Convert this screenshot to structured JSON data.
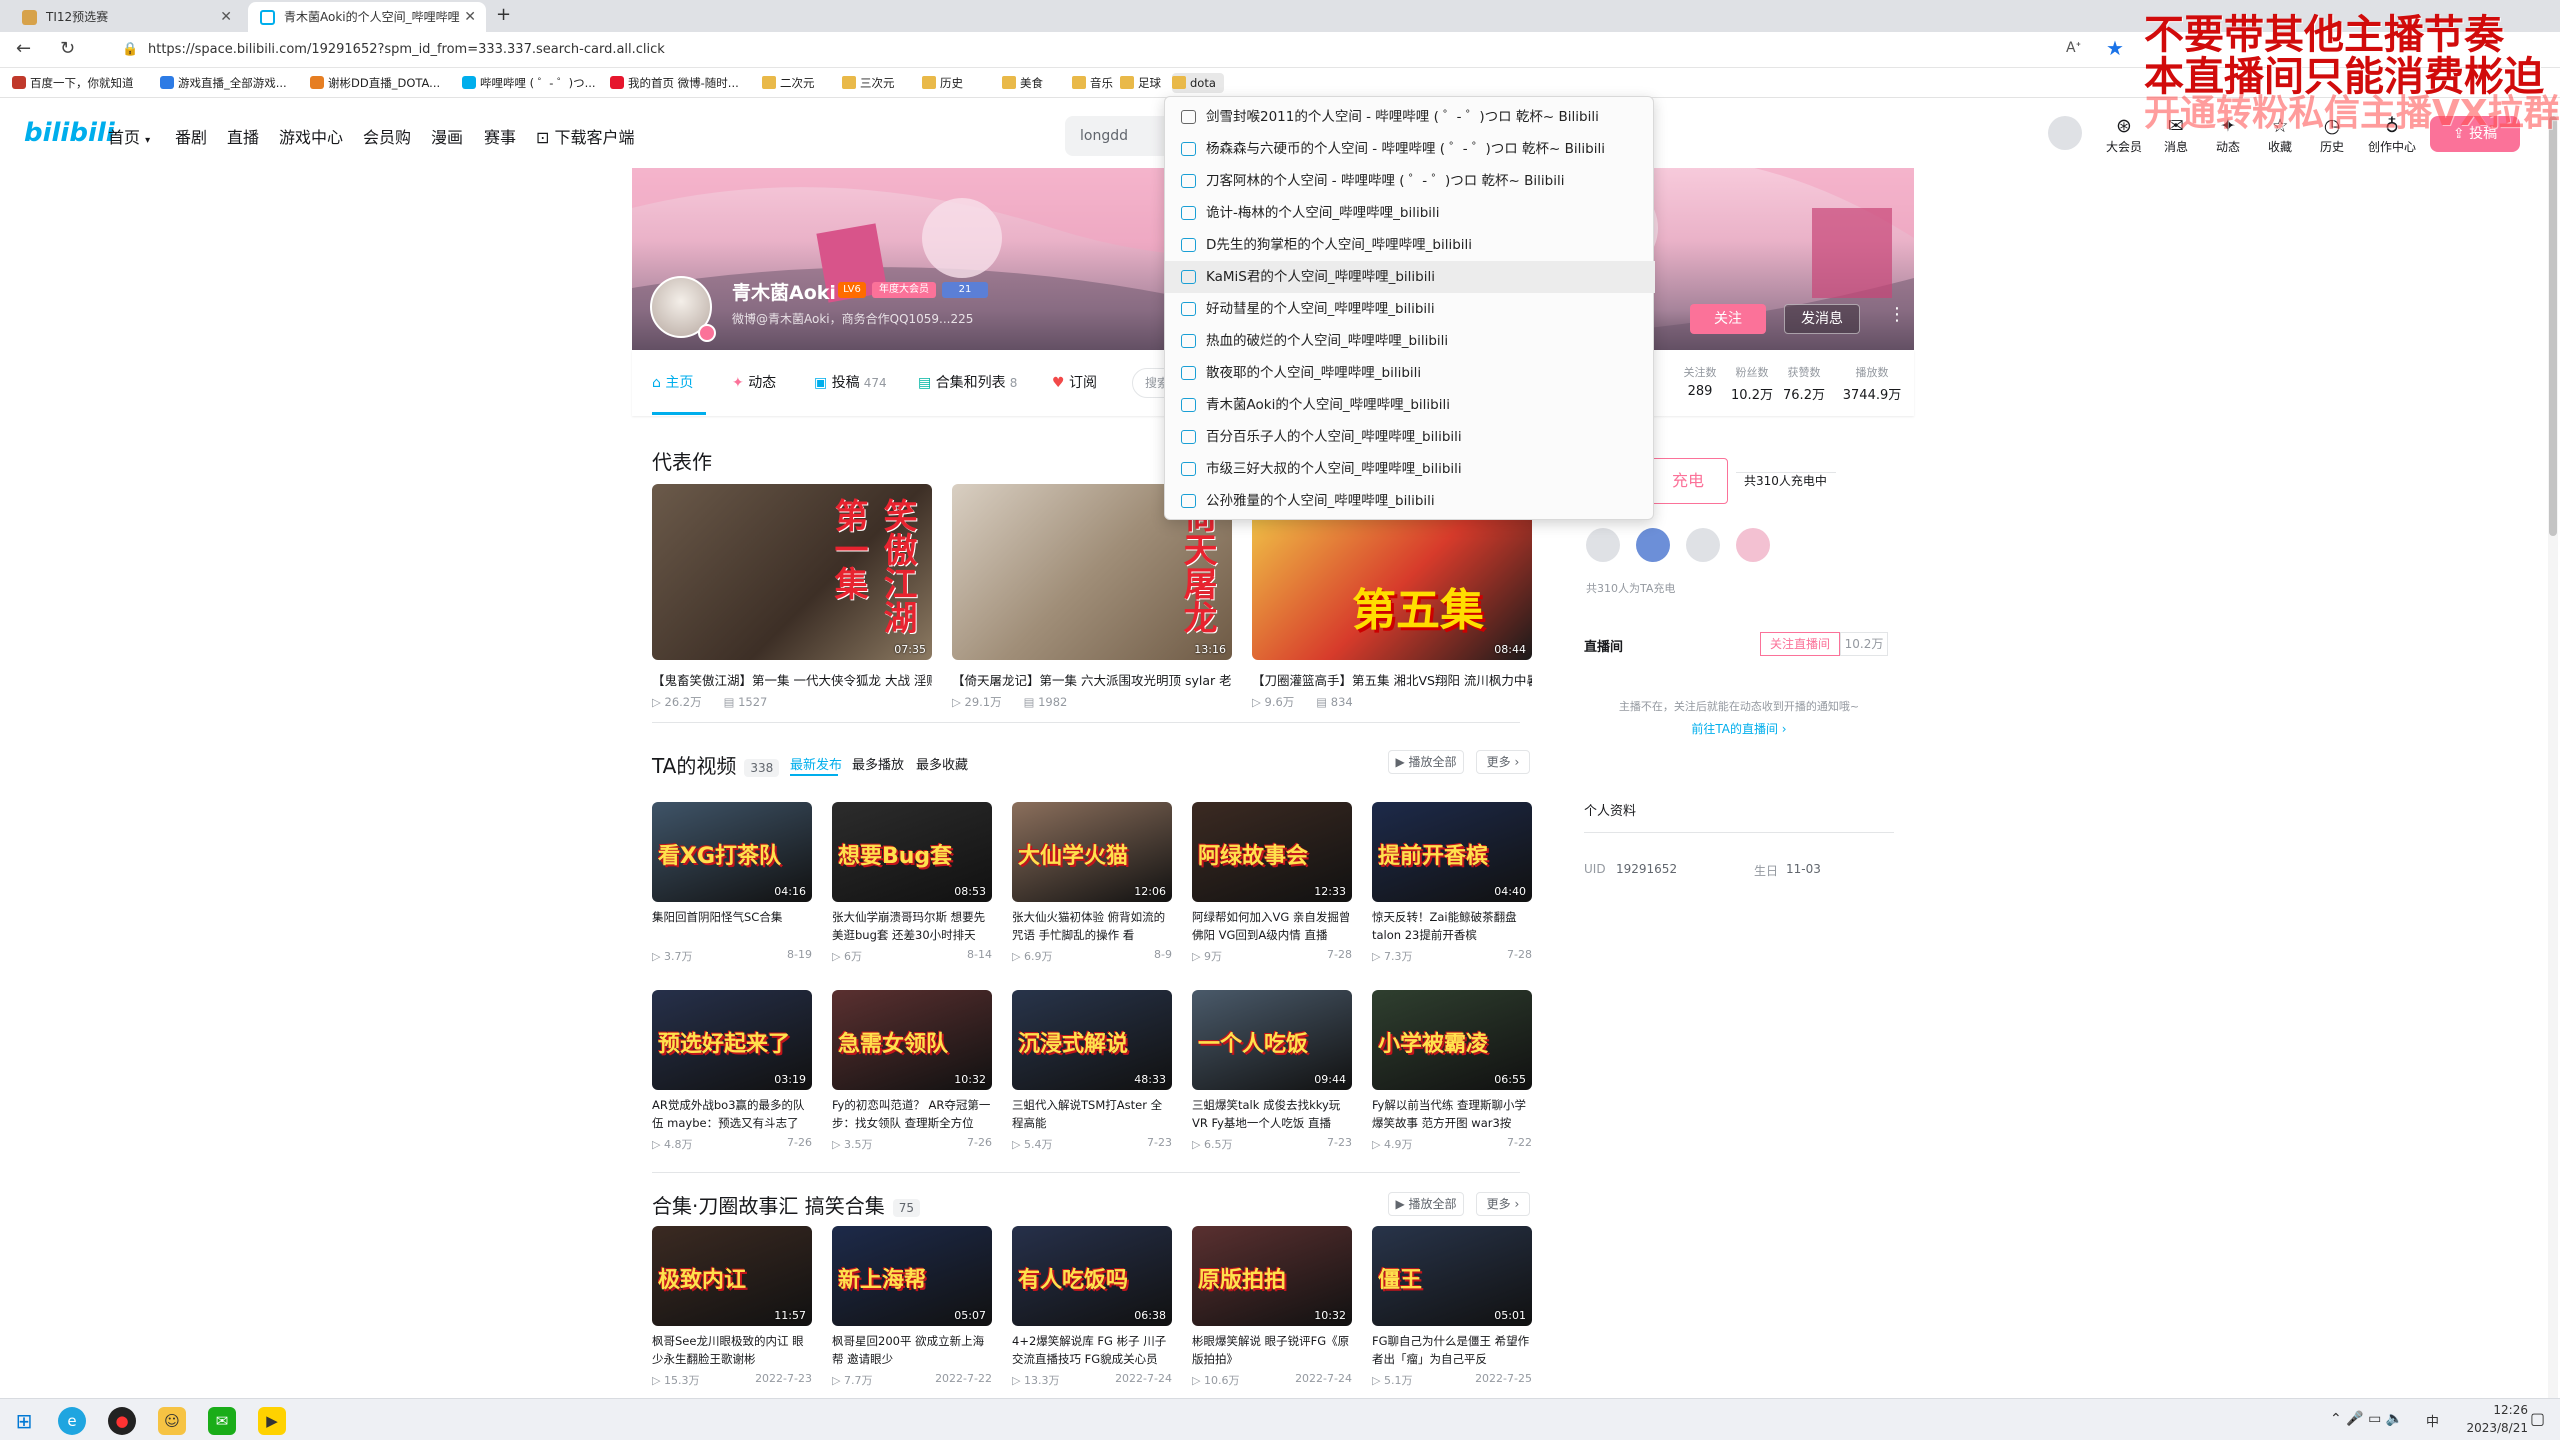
{
  "browser": {
    "tabs": [
      {
        "label": "TI12预选赛",
        "active": false
      },
      {
        "label": "青木菌Aoki的个人空间_哔哩哔哩",
        "active": true
      }
    ],
    "new_tab_symbol": "+",
    "url": "https://space.bilibili.com/19291652?spm_id_from=333.337.search-card.all.click",
    "bookmarks": [
      {
        "label": "百度一下，你就知道",
        "icon": "globe-icon"
      },
      {
        "label": "游戏直播_全部游戏...",
        "icon": "site-icon"
      },
      {
        "label": "谢彬DD直播_DOTA...",
        "icon": "site-icon"
      },
      {
        "label": "哔哩哔哩 ( ゜- ゜)つ...",
        "icon": "bilibili-icon"
      },
      {
        "label": "我的首页 微博-随时...",
        "icon": "weibo-icon"
      },
      {
        "label": "二次元",
        "icon": "folder-icon"
      },
      {
        "label": "三次元",
        "icon": "folder-icon"
      },
      {
        "label": "历史",
        "icon": "folder-icon"
      },
      {
        "label": "美食",
        "icon": "folder-icon"
      },
      {
        "label": "音乐",
        "icon": "folder-icon"
      },
      {
        "label": "足球",
        "icon": "folder-icon"
      },
      {
        "label": "dota",
        "icon": "folder-icon"
      }
    ]
  },
  "dropdown_items": [
    "剑雪封喉2011的个人空间 - 哔哩哔哩 ( ゜- ゜)つロ 乾杯~ Bilibili",
    "杨森森与六硬币的个人空间 - 哔哩哔哩 ( ゜- ゜)つロ 乾杯~ Bilibili",
    "刀客阿林的个人空间 - 哔哩哔哩 ( ゜- ゜)つロ 乾杯~ Bilibili",
    "诡计-梅林的个人空间_哔哩哔哩_bilibili",
    "D先生的狗掌柜的个人空间_哔哩哔哩_bilibili",
    "KaMiS君的个人空间_哔哩哔哩_bilibili",
    "好动彗星的个人空间_哔哩哔哩_bilibili",
    "热血的破烂的个人空间_哔哩哔哩_bilibili",
    "散夜耶的个人空间_哔哩哔哩_bilibili",
    "青木菌Aoki的个人空间_哔哩哔哩_bilibili",
    "百分百乐子人的个人空间_哔哩哔哩_bilibili",
    "市级三好大叔的个人空间_哔哩哔哩_bilibili",
    "公孙雅量的个人空间_哔哩哔哩_bilibili"
  ],
  "site_header": {
    "logo": "bilibili",
    "nav": [
      "首页",
      "番剧",
      "直播",
      "游戏中心",
      "会员购",
      "漫画",
      "赛事",
      "下载客户端"
    ],
    "search_value": "longdd",
    "right_items": [
      "大会员",
      "消息",
      "动态",
      "收藏",
      "历史",
      "创作中心"
    ],
    "upload_label": "投稿"
  },
  "profile": {
    "name": "青木菌Aoki",
    "level": "LV6",
    "vip_badge": "年度大会员",
    "fans_medal": "21",
    "sign": "微博@青木菌Aoki，商务合作QQ1059...225",
    "follow_label": "关注",
    "message_label": "发消息",
    "more_symbol": "⋮",
    "tabs": [
      {
        "label": "主页",
        "count": ""
      },
      {
        "label": "动态",
        "count": ""
      },
      {
        "label": "投稿",
        "count": "474"
      },
      {
        "label": "合集和列表",
        "count": "8"
      },
      {
        "label": "订阅",
        "count": ""
      }
    ],
    "search_placeholder": "搜索",
    "stats": [
      {
        "label": "关注数",
        "value": "289"
      },
      {
        "label": "粉丝数",
        "value": "10.2万"
      },
      {
        "label": "获赞数",
        "value": "76.2万"
      },
      {
        "label": "播放数",
        "value": "3744.9万"
      }
    ]
  },
  "masterpieces": {
    "title": "代表作",
    "items": [
      {
        "title": "【鬼畜笑傲江湖】第一集 一代大侠令狐龙 大战 淫贼",
        "views": "26.2万",
        "danmaku": "1527",
        "duration": "07:35",
        "cap": "笑傲江湖 第一集"
      },
      {
        "title": "【倚天屠龙记】第一集 六大派围攻光明顶 sylar 老师",
        "views": "29.1万",
        "danmaku": "1982",
        "duration": "13:16",
        "cap": "倚天屠龙"
      },
      {
        "title": "【刀圈灌篮高手】第五集 湘北VS翔阳 流川枫力中暑",
        "views": "9.6万",
        "danmaku": "834",
        "duration": "08:44",
        "cap": "第五集"
      }
    ]
  },
  "videos": {
    "title": "TA的视频",
    "count": "338",
    "sort_tabs": [
      "最新发布",
      "最多播放",
      "最多收藏"
    ],
    "play_all": "播放全部",
    "more": "更多",
    "items": [
      {
        "title": "集阳回首阴阳怪气SC合集",
        "views": "3.7万",
        "date": "8-19",
        "duration": "04:16",
        "cap": "看XG打茶队"
      },
      {
        "title": "张大仙学崩溃哥玛尔斯 想要先美逛bug套 还差30小时排天",
        "views": "6万",
        "date": "8-14",
        "duration": "08:53",
        "cap": "想要Bug套"
      },
      {
        "title": "张大仙火猫初体验 俯背如流的咒语 手忙脚乱的操作 看",
        "views": "6.9万",
        "date": "8-9",
        "duration": "12:06",
        "cap": "大仙学火猫"
      },
      {
        "title": "阿绿帮如何加入VG 亲自发掘曾佛阳 VG回到A级内情 直播",
        "views": "9万",
        "date": "7-28",
        "duration": "12:33",
        "cap": "阿绿故事会"
      },
      {
        "title": "惊天反转！Zai能鲸破茶翻盘 talon 23提前开香槟",
        "views": "7.3万",
        "date": "7-28",
        "duration": "04:40",
        "cap": "提前开香槟"
      },
      {
        "title": "AR觉成外战bo3赢的最多的队伍 maybe：预选又有斗志了",
        "views": "4.8万",
        "date": "7-26",
        "duration": "03:19",
        "cap": "预选好起来了"
      },
      {
        "title": "Fy的初恋叫范道？ AR夺冠第一步：找女领队 查理斯全方位",
        "views": "3.5万",
        "date": "7-26",
        "duration": "10:32",
        "cap": "急需女领队"
      },
      {
        "title": "三蛆代入解说TSM打Aster 全程高能",
        "views": "5.4万",
        "date": "7-23",
        "duration": "48:33",
        "cap": "沉浸式解说"
      },
      {
        "title": "三蛆爆笑talk 成俊去找kky玩 VR Fy基地一个人吃饭 直播",
        "views": "6.5万",
        "date": "7-23",
        "duration": "09:44",
        "cap": "一个人吃饭"
      },
      {
        "title": "Fy解以前当代练 查理斯聊小学爆笑故事 范方开图 war3按",
        "views": "4.9万",
        "date": "7-22",
        "duration": "06:55",
        "cap": "小学被霸凌"
      }
    ]
  },
  "collection": {
    "title": "合集·刀圈故事汇 搞笑合集",
    "count": "75",
    "play_all": "播放全部",
    "more": "更多",
    "items": [
      {
        "title": "枫哥See龙川眼极致的内讧 眼少永生翻脸王歌谢彬",
        "views": "15.3万",
        "date": "2022-7-23",
        "duration": "11:57",
        "cap": "极致内讧"
      },
      {
        "title": "枫哥星回200平 欲成立新上海帮 邀请眼少",
        "views": "7.7万",
        "date": "2022-7-22",
        "duration": "05:07",
        "cap": "新上海帮"
      },
      {
        "title": "4+2爆笑解说库 FG 彬子 川子交流直播技巧 FG貌成关心员",
        "views": "13.3万",
        "date": "2022-7-24",
        "duration": "06:38",
        "cap": "有人吃饭吗"
      },
      {
        "title": "彬眼爆笑解说 眼子锐评FG《原版拍拍》",
        "views": "10.6万",
        "date": "2022-7-24",
        "duration": "10:32",
        "cap": "原版拍拍"
      },
      {
        "title": "FG聊自己为什么是僵王 希望作者出「瘤」为自己平反",
        "views": "5.1万",
        "date": "2022-7-25",
        "duration": "05:01",
        "cap": "僵王"
      }
    ]
  },
  "sidebar": {
    "charge_label": "充电",
    "charge_count": "共310人充电中",
    "charge_footer": "共310人为TA充电",
    "live_title": "直播间",
    "live_follow": "关注直播间",
    "live_count": "10.2万",
    "live_status": "主播不在，关注后就能在动态收到开播的通知哦~",
    "live_link": "前往TA的直播间 ›",
    "info_title": "个人资料",
    "uid_label": "UID",
    "uid": "19291652",
    "birthday_label": "生日",
    "birthday": "11-03"
  },
  "overlay": {
    "line1": "不要带其他主播节奏",
    "line2": "本直播间只能消费彬迫",
    "line3": "开通转粉私信主播VX拉群"
  },
  "taskbar": {
    "time": "12:26",
    "date": "2023/8/21",
    "ime": "中"
  },
  "colors": {
    "pink": "#fb7299",
    "blue": "#00aeec",
    "overlay_red": "#d10b0b"
  }
}
